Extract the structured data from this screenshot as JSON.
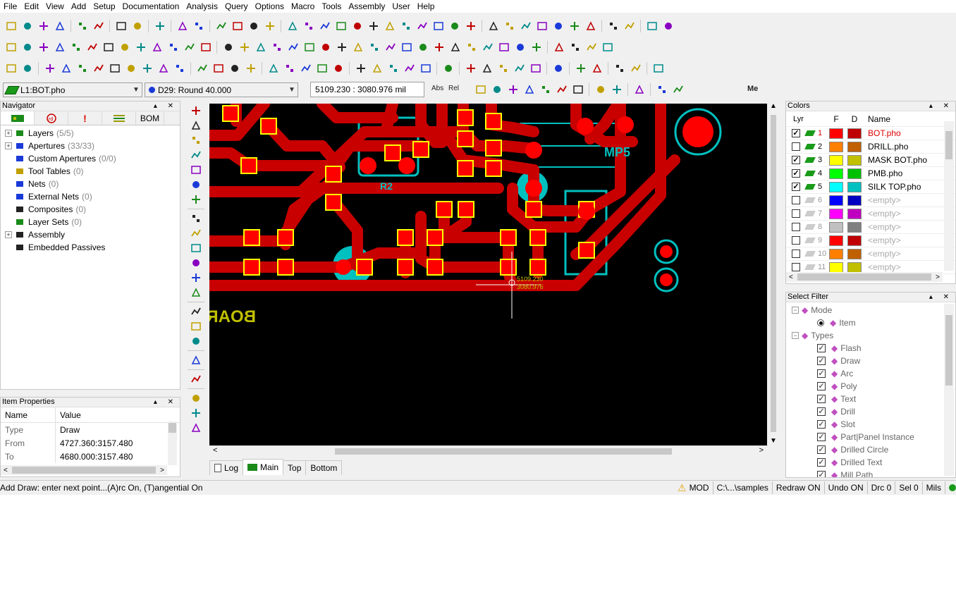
{
  "menu": [
    "File",
    "Edit",
    "View",
    "Add",
    "Setup",
    "Documentation",
    "Analysis",
    "Query",
    "Options",
    "Macro",
    "Tools",
    "Assembly",
    "User",
    "Help"
  ],
  "layer_combo": "L1:BOT.pho",
  "aperture_combo": "D29: Round 40.000",
  "coord_readout": "5109.230 : 3080.976 mil",
  "mode_abs": "Abs",
  "mode_rel": "Rel",
  "mode_me": "Me",
  "navigator": {
    "title": "Navigator",
    "bom_tab": "BOM",
    "items": [
      {
        "label": "Layers",
        "count": "(5/5)",
        "exp": true
      },
      {
        "label": "Apertures",
        "count": "(33/33)",
        "exp": true
      },
      {
        "label": "Custom Apertures",
        "count": "(0/0)",
        "exp": false
      },
      {
        "label": "Tool Tables",
        "count": "(0)",
        "exp": false
      },
      {
        "label": "Nets",
        "count": "(0)",
        "exp": false
      },
      {
        "label": "External Nets",
        "count": "(0)",
        "exp": false
      },
      {
        "label": "Composites",
        "count": "(0)",
        "exp": false
      },
      {
        "label": "Layer Sets",
        "count": "(0)",
        "exp": false
      },
      {
        "label": "Assembly",
        "count": "",
        "exp": true
      },
      {
        "label": "Embedded Passives",
        "count": "",
        "exp": false
      }
    ]
  },
  "item_properties": {
    "title": "Item Properties",
    "col_name": "Name",
    "col_value": "Value",
    "rows": [
      {
        "name": "Type",
        "value": "Draw"
      },
      {
        "name": "From",
        "value": "4727.360:3157.480"
      },
      {
        "name": "To",
        "value": "4680.000:3157.480"
      }
    ]
  },
  "canvas_labels": {
    "cursor_x": "5109.230",
    "cursor_y": "3080.976",
    "silk_mp5": "MP5",
    "silk_r2": "R2",
    "silk_boards": "BOARDS"
  },
  "bottom_tabs": [
    "Log",
    "Main",
    "Top",
    "Bottom"
  ],
  "colors_panel": {
    "title": "Colors",
    "headers": {
      "lyr": "Lyr",
      "f": "F",
      "d": "D",
      "name": "Name"
    },
    "rows": [
      {
        "num": "1",
        "name": "BOT.pho",
        "checked": true,
        "f": "#ff0000",
        "d": "#c00000",
        "active": true
      },
      {
        "num": "2",
        "name": "DRILL.pho",
        "checked": false,
        "f": "#ff8000",
        "d": "#c06000",
        "active": false
      },
      {
        "num": "3",
        "name": "MASK BOT.pho",
        "checked": true,
        "f": "#ffff00",
        "d": "#c0c000",
        "active": false
      },
      {
        "num": "4",
        "name": "PMB.pho",
        "checked": true,
        "f": "#00ff00",
        "d": "#00c000",
        "active": false
      },
      {
        "num": "5",
        "name": "SILK TOP.pho",
        "checked": true,
        "f": "#00ffff",
        "d": "#00c0c0",
        "active": false
      },
      {
        "num": "6",
        "name": "<empty>",
        "checked": false,
        "f": "#0000ff",
        "d": "#0000c0",
        "active": false
      },
      {
        "num": "7",
        "name": "<empty>",
        "checked": false,
        "f": "#ff00ff",
        "d": "#c000c0",
        "active": false
      },
      {
        "num": "8",
        "name": "<empty>",
        "checked": false,
        "f": "#c0c0c0",
        "d": "#808080",
        "active": false
      },
      {
        "num": "9",
        "name": "<empty>",
        "checked": false,
        "f": "#ff0000",
        "d": "#c00000",
        "active": false
      },
      {
        "num": "10",
        "name": "<empty>",
        "checked": false,
        "f": "#ff8000",
        "d": "#c06000",
        "active": false
      },
      {
        "num": "11",
        "name": "<empty>",
        "checked": false,
        "f": "#ffff00",
        "d": "#c0c000",
        "active": false
      }
    ]
  },
  "select_filter": {
    "title": "Select Filter",
    "mode_label": "Mode",
    "mode_item": "Item",
    "types_label": "Types",
    "types": [
      "Flash",
      "Draw",
      "Arc",
      "Poly",
      "Text",
      "Drill",
      "Slot",
      "Part|Panel Instance",
      "Drilled Circle",
      "Drilled Text",
      "Mill Path"
    ]
  },
  "status": {
    "message": "Add Draw: enter next point...(A)rc On, (T)angential On",
    "mod": "MOD",
    "path": "C:\\...\\samples",
    "redraw": "Redraw ON",
    "undo": "Undo ON",
    "drc": "Drc 0",
    "sel": "Sel 0",
    "units": "Mils"
  },
  "colors": {
    "trace": "#c80000",
    "pad": "#ff0000",
    "pad_border": "#ffff00",
    "silk": "#00c0c0",
    "canvas_bg": "#000000"
  }
}
